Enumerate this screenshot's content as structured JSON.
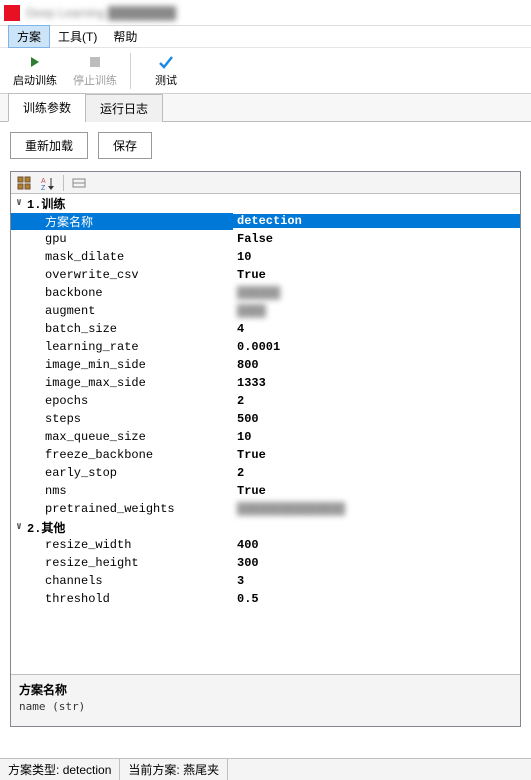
{
  "window": {
    "title": "Deep Learning ████████"
  },
  "menu": {
    "items": [
      "方案",
      "工具(T)",
      "帮助"
    ],
    "active_index": 0
  },
  "toolbar": {
    "start_label": "启动训练",
    "stop_label": "停止训练",
    "test_label": "测试"
  },
  "tabs": {
    "items": [
      "训练参数",
      "运行日志"
    ],
    "active_index": 0
  },
  "buttons": {
    "reload": "重新加载",
    "save": "保存"
  },
  "property_grid": {
    "groups": [
      {
        "title": "1.训练",
        "rows": [
          {
            "name": "方案名称",
            "value": "detection",
            "selected": true
          },
          {
            "name": "gpu",
            "value": "False"
          },
          {
            "name": "mask_dilate",
            "value": "10"
          },
          {
            "name": "overwrite_csv",
            "value": "True"
          },
          {
            "name": "backbone",
            "value": "██████",
            "blur": true
          },
          {
            "name": "augment",
            "value": "████",
            "blur": true
          },
          {
            "name": "batch_size",
            "value": "4"
          },
          {
            "name": "learning_rate",
            "value": "0.0001"
          },
          {
            "name": "image_min_side",
            "value": "800"
          },
          {
            "name": "image_max_side",
            "value": "1333"
          },
          {
            "name": "epochs",
            "value": "2"
          },
          {
            "name": "steps",
            "value": "500"
          },
          {
            "name": "max_queue_size",
            "value": "10"
          },
          {
            "name": "freeze_backbone",
            "value": "True"
          },
          {
            "name": "early_stop",
            "value": "2"
          },
          {
            "name": "nms",
            "value": "True"
          },
          {
            "name": "pretrained_weights",
            "value": "███████████████",
            "blur": true
          }
        ]
      },
      {
        "title": "2.其他",
        "rows": [
          {
            "name": "resize_width",
            "value": "400"
          },
          {
            "name": "resize_height",
            "value": "300"
          },
          {
            "name": "channels",
            "value": "3"
          },
          {
            "name": "threshold",
            "value": "0.5"
          }
        ]
      }
    ],
    "description": {
      "title": "方案名称",
      "body": "name (str)"
    }
  },
  "status": {
    "type_label": "方案类型:",
    "type_value": "detection",
    "current_label": "当前方案:",
    "current_value": "燕尾夹"
  }
}
